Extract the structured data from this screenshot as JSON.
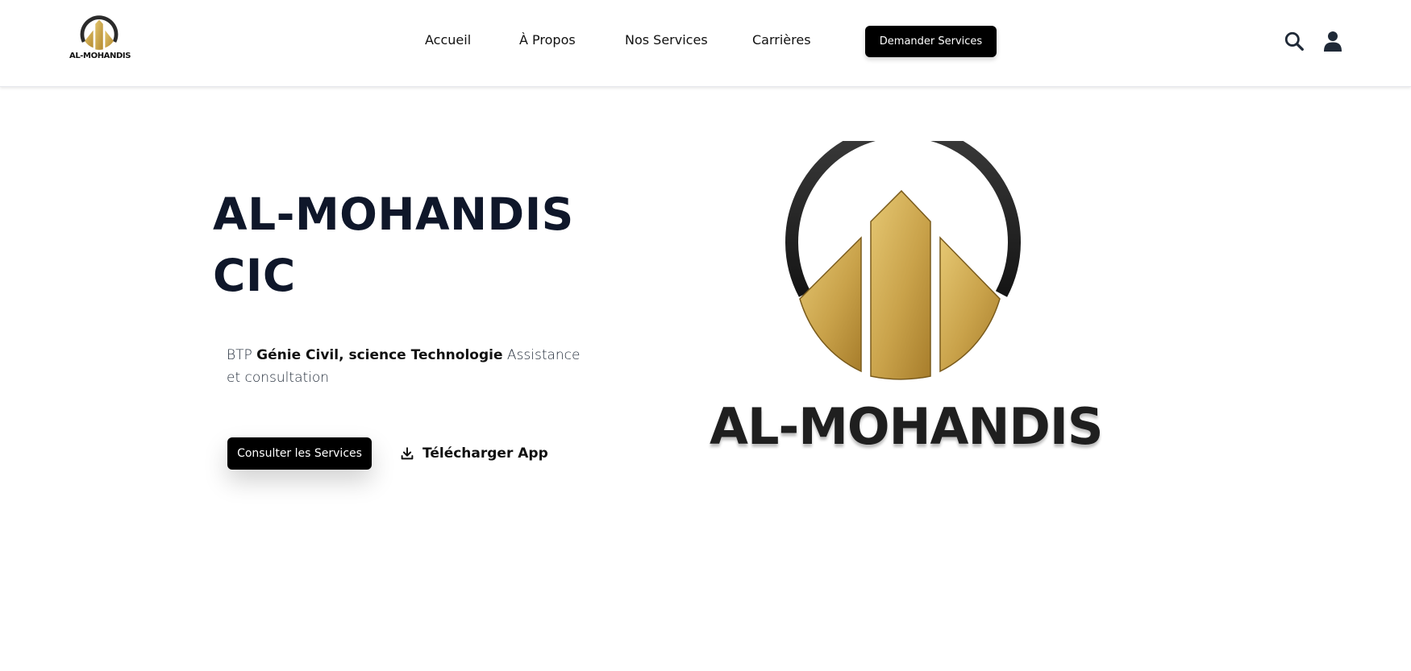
{
  "brand": {
    "name": "AL-MOHANDIS",
    "colors": {
      "gold": "#C9A24A",
      "ring": "#2B2B2B"
    }
  },
  "nav": {
    "items": [
      {
        "label": "Accueil"
      },
      {
        "label": "À Propos"
      },
      {
        "label": "Nos Services"
      },
      {
        "label": "Carrières"
      }
    ],
    "cta_label": "Demander Services"
  },
  "header_icons": [
    "search-icon",
    "user-icon"
  ],
  "hero": {
    "title_line1": "AL-MOHANDIS",
    "title_line2": "CIC",
    "desc_part1": "BTP ",
    "desc_bold": "Génie Civil, science Technologie",
    "desc_part2": " Assistance et consultation",
    "primary_button": "Consulter les Services",
    "secondary_button": "Télécharger App",
    "logo_text": "AL-MOHANDIS"
  }
}
